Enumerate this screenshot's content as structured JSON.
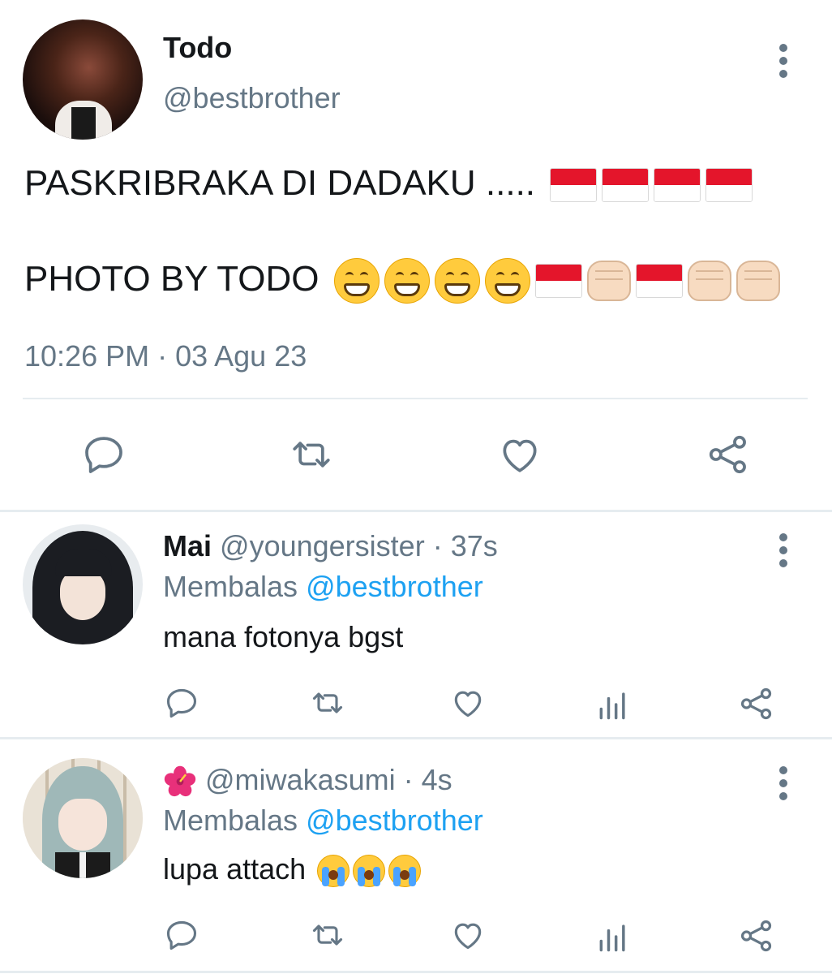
{
  "main_tweet": {
    "display_name": "Todo",
    "handle": "@bestbrother",
    "line1": "PASKRIBRAKA DI DADAKU .....",
    "line2": "PHOTO BY TODO",
    "timestamp": "10:26 PM · 03 Agu 23"
  },
  "replies": [
    {
      "display_name": "Mai",
      "handle": "@youngersister",
      "time": "· 37s",
      "reply_prefix": "Membalas",
      "reply_to": "@bestbrother",
      "text": "mana fotonya bgst"
    },
    {
      "display_name": "",
      "handle": "@miwakasumi",
      "time": "· 4s",
      "reply_prefix": "Membalas",
      "reply_to": "@bestbrother",
      "text": "lupa attach"
    }
  ],
  "icons": {
    "reply": "reply-icon",
    "retweet": "retweet-icon",
    "like": "like-icon",
    "share": "share-icon",
    "analytics": "analytics-icon",
    "more": "more-options-icon"
  },
  "colors": {
    "icon_gray": "#657786",
    "link_blue": "#1da1f2",
    "divider": "#e6ecf0"
  }
}
